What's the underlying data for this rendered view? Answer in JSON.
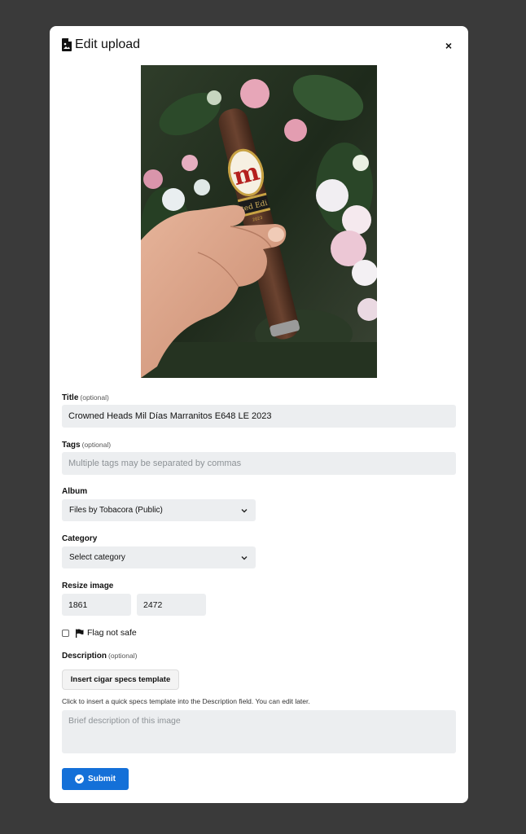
{
  "modal": {
    "title": "Edit upload",
    "close_label": "×"
  },
  "photo": {
    "label_text": "ted Edi",
    "year_text": "2023",
    "monogram": "m"
  },
  "fields": {
    "title": {
      "label": "Title",
      "optional": "(optional)",
      "value": "Crowned Heads Mil Días Marranitos E648 LE 2023"
    },
    "tags": {
      "label": "Tags",
      "optional": "(optional)",
      "placeholder": "Multiple tags may be separated by commas"
    },
    "album": {
      "label": "Album",
      "selected": "Files by Tobacora (Public)"
    },
    "category": {
      "label": "Category",
      "selected": "Select category"
    },
    "resize": {
      "label": "Resize image",
      "width": "1861",
      "height": "2472"
    },
    "nsfw": {
      "label": "Flag not safe"
    },
    "description": {
      "label": "Description",
      "optional": "(optional)",
      "template_button": "Insert cigar specs template",
      "helper": "Click to insert a quick specs template into the Description field. You can edit later.",
      "placeholder": "Brief description of this image"
    }
  },
  "submit_label": "Submit",
  "colors": {
    "backdrop": "#3a3a3a",
    "accent": "#1470d8",
    "input_bg": "#eceef0"
  }
}
